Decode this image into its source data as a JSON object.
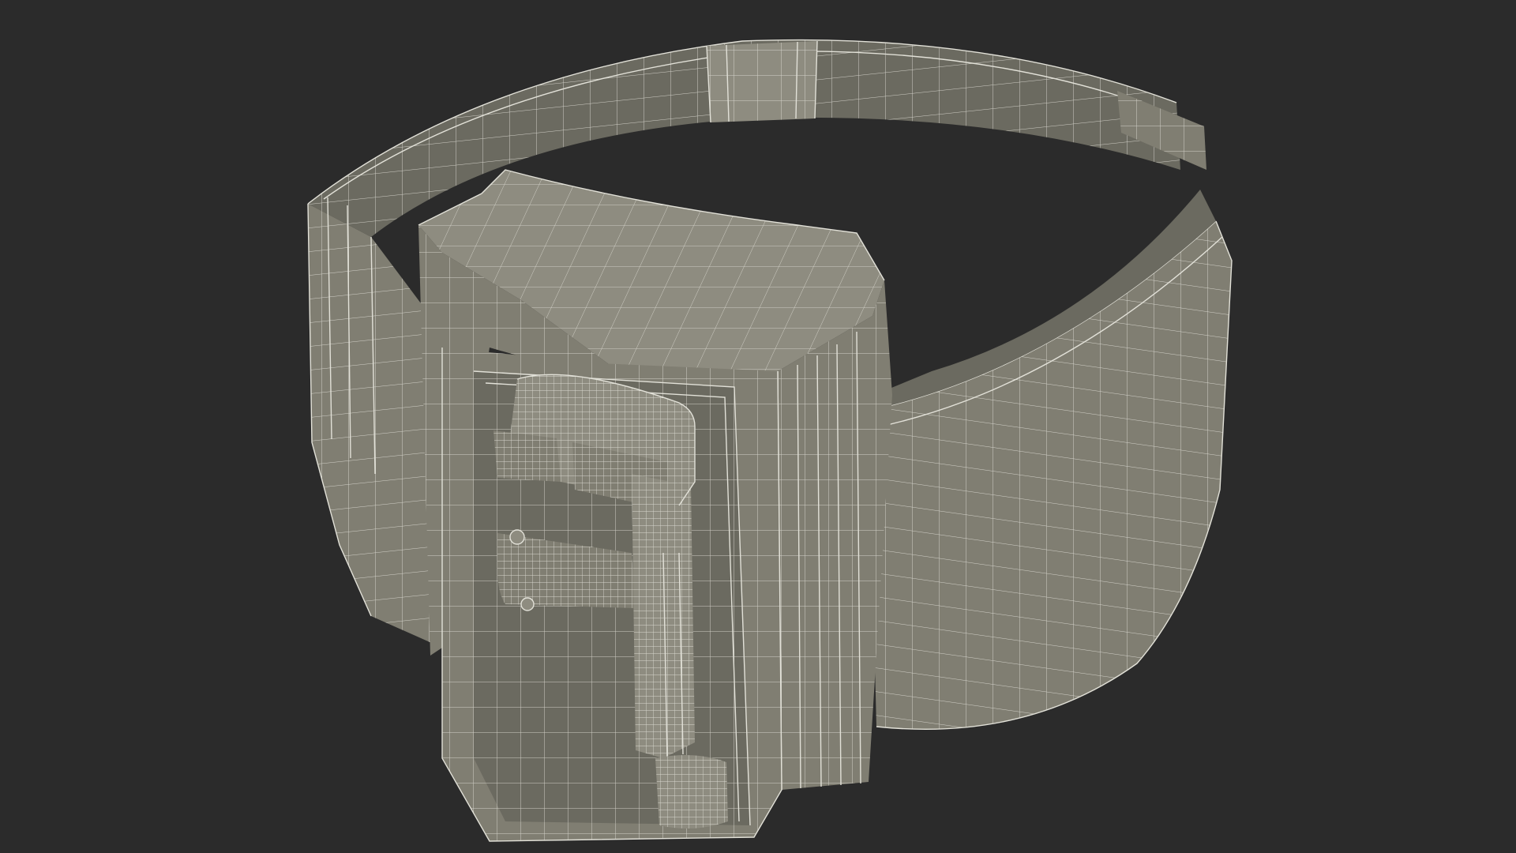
{
  "scene": {
    "subject": "ankle-monitor-bracelet-wireframe",
    "background_color": "#2b2b2b",
    "surface_color": "#807e72",
    "surface_dark_color": "#6b6a60",
    "surface_light_color": "#8e8c80",
    "wire_color": "#e2e1d8"
  }
}
